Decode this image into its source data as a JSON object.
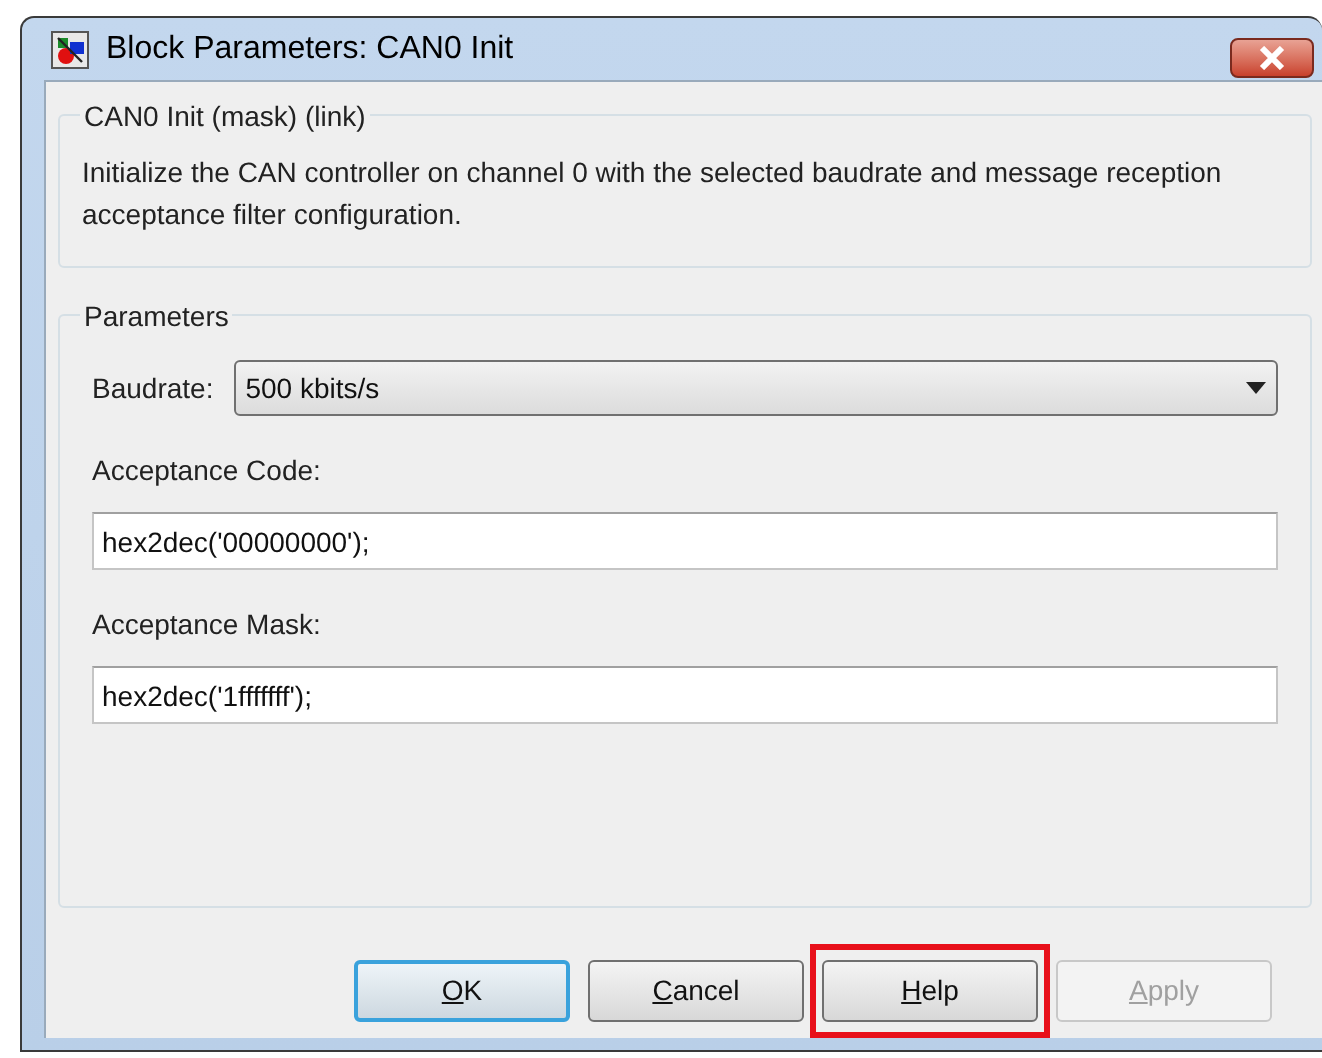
{
  "window": {
    "title": "Block Parameters: CAN0 Init"
  },
  "description_group": {
    "title": "CAN0 Init (mask) (link)",
    "text": "Initialize the CAN controller on channel 0 with the selected baudrate and message reception acceptance filter configuration."
  },
  "parameters_group": {
    "title": "Parameters",
    "fields": [
      {
        "kind": "dropdown",
        "label": "Baudrate:",
        "value": "500 kbits/s"
      },
      {
        "kind": "text",
        "label": "Acceptance Code:",
        "value": "hex2dec('00000000');"
      },
      {
        "kind": "text",
        "label": "Acceptance Mask:",
        "value": "hex2dec('1fffffff');"
      }
    ]
  },
  "buttons": [
    {
      "label": "OK",
      "default": true,
      "disabled": false,
      "highlighted": false,
      "mnemonic": true
    },
    {
      "label": "Cancel",
      "default": false,
      "disabled": false,
      "highlighted": false,
      "mnemonic": true
    },
    {
      "label": "Help",
      "default": false,
      "disabled": false,
      "highlighted": true,
      "mnemonic": true
    },
    {
      "label": "Apply",
      "default": false,
      "disabled": true,
      "highlighted": false,
      "mnemonic": true
    }
  ]
}
